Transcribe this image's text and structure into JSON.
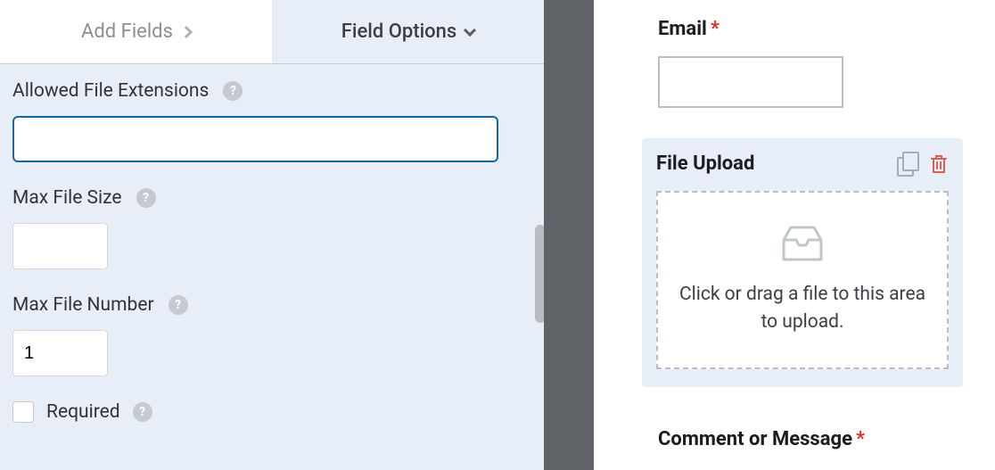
{
  "tabs": {
    "add_fields": "Add Fields",
    "field_options": "Field Options"
  },
  "options": {
    "allowed_extensions_label": "Allowed File Extensions",
    "allowed_extensions_value": "",
    "max_file_size_label": "Max File Size",
    "max_file_size_value": "",
    "max_file_number_label": "Max File Number",
    "max_file_number_value": "1",
    "required_label": "Required"
  },
  "preview": {
    "email_label": "Email",
    "file_upload_label": "File Upload",
    "dropzone_text": "Click or drag a file to this area to upload.",
    "comment_label": "Comment or Message"
  }
}
